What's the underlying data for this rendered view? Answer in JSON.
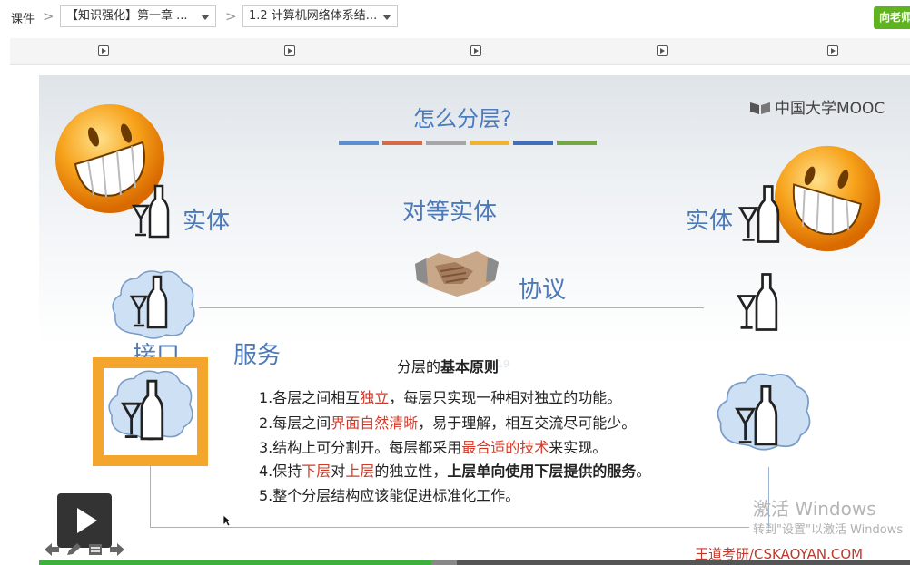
{
  "breadcrumb": {
    "root": "课件",
    "separator": ">",
    "chapter_select": "【知识强化】第一章 ...",
    "section_select": "1.2 计算机网络体系结..."
  },
  "ask_button": "向老师",
  "tabs": [
    {
      "icon": "video-play-icon",
      "active": true
    },
    {
      "icon": "video-play-icon",
      "active": false
    },
    {
      "icon": "video-play-icon",
      "active": false
    },
    {
      "icon": "video-play-icon",
      "active": false
    },
    {
      "icon": "video-play-icon",
      "active": false
    }
  ],
  "slide": {
    "title": "怎么分层?",
    "bar_colors": [
      "#5b8fcf",
      "#d66a46",
      "#a6a6a6",
      "#f0b432",
      "#3f6fb8",
      "#74a843"
    ],
    "logo": "中国大学MOOC",
    "entity_left": "实体",
    "peer_entity": "对等实体",
    "entity_right": "实体",
    "protocol": "协议",
    "interface": "接口",
    "service": "服务",
    "principles_title_plain": "分层的",
    "principles_title_bold": "基本原则",
    "rules": [
      {
        "parts": [
          {
            "t": "1.各层之间相互",
            "s": "n"
          },
          {
            "t": "独立",
            "s": "r"
          },
          {
            "t": "，每层只实现一种相对独立的功能。",
            "s": "n"
          }
        ]
      },
      {
        "parts": [
          {
            "t": "2.每层之间",
            "s": "n"
          },
          {
            "t": "界面自然清晰",
            "s": "r"
          },
          {
            "t": "，易于理解，相互交流尽可能少。",
            "s": "n"
          }
        ]
      },
      {
        "parts": [
          {
            "t": "3.结构上可分割开。每层都采用",
            "s": "n"
          },
          {
            "t": "最合适的技术",
            "s": "r"
          },
          {
            "t": "来实现。",
            "s": "n"
          }
        ]
      },
      {
        "parts": [
          {
            "t": "4.保持",
            "s": "n"
          },
          {
            "t": "下层",
            "s": "r"
          },
          {
            "t": "对",
            "s": "n"
          },
          {
            "t": "上层",
            "s": "r"
          },
          {
            "t": "的独立性，",
            "s": "n"
          },
          {
            "t": "上层单向使用下层提供的服务",
            "s": "b"
          },
          {
            "t": "。",
            "s": "n"
          }
        ]
      },
      {
        "parts": [
          {
            "t": "5.整个分层结构应该能促进标准化工作。",
            "s": "n"
          }
        ]
      }
    ],
    "faint_text": "2019",
    "win_activate": "激活 Windows",
    "win_activate_sub": "转到\"设置\"以激活 Windows",
    "site_watermark": "王道考研/CSKAOYAN.COM"
  },
  "player": {
    "play_icon": "play-icon",
    "progress_fraction": 0.45,
    "buffer_fraction": 0.48,
    "tools": [
      "arrow-left-icon",
      "pen-icon",
      "eraser-icon",
      "arrow-right-icon"
    ]
  }
}
